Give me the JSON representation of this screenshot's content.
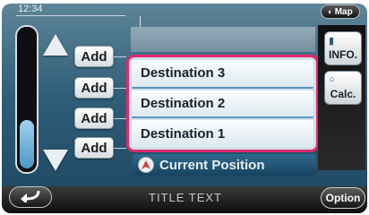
{
  "status": {
    "time": "12:34"
  },
  "top_right": {
    "map_label": "Map",
    "map_icon": "map-icon"
  },
  "level_gauge": {
    "fill_fraction": 0.35
  },
  "scroll": {
    "up_icon": "up-arrow-icon",
    "down_icon": "down-arrow-icon"
  },
  "add_buttons": [
    "Add",
    "Add",
    "Add",
    "Add"
  ],
  "destinations": [
    "Destination 3",
    "Destination 2",
    "Destination 1"
  ],
  "current_position": {
    "label": "Current Position",
    "icon": "location-pin-icon"
  },
  "side_buttons": {
    "info_label": "INFO.",
    "calc_label": "Calc."
  },
  "bottom_bar": {
    "back_icon": "back-arrow-icon",
    "title": "TITLE TEXT",
    "option_label": "Option"
  },
  "colors": {
    "highlight_border": "#e2286f",
    "gauge_fill": "#4b99c6",
    "screen_bg": "#2f5e78"
  }
}
